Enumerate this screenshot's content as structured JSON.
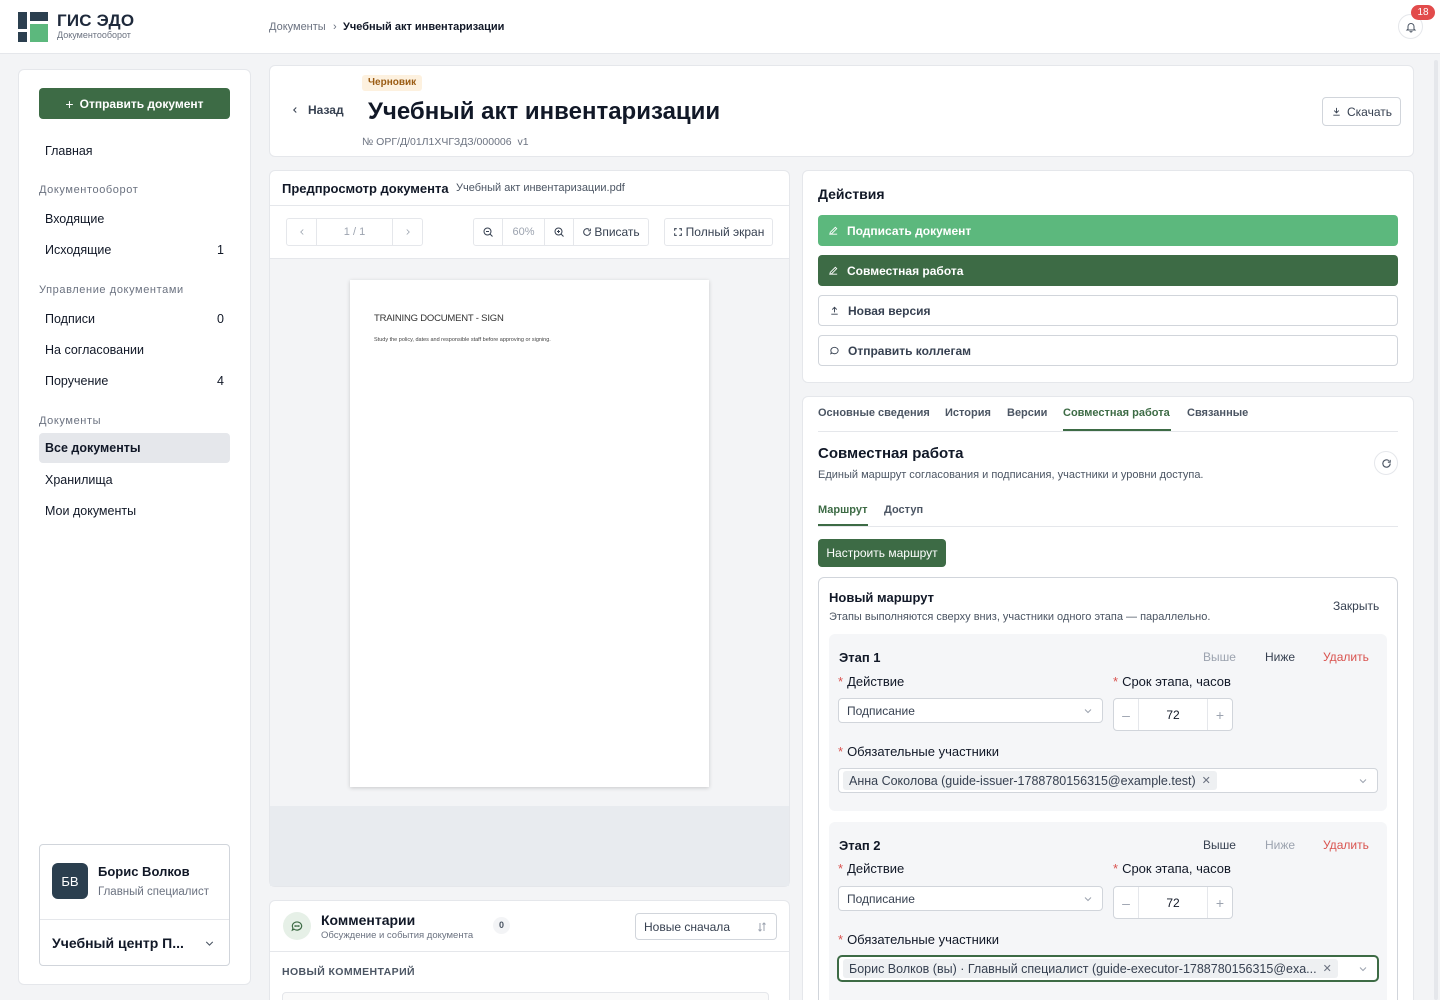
{
  "app": {
    "title": "ГИС ЭДО",
    "subtitle": "Документооборот"
  },
  "breadcrumb": {
    "parent": "Документы",
    "separator": "›",
    "current": "Учебный акт инвентаризации"
  },
  "notifications": {
    "count": "18",
    "icon": "bell-icon"
  },
  "sidebar": {
    "send_button": "Отправить документ",
    "home": "Главная",
    "groups": [
      {
        "title": "Документооборот",
        "items": [
          {
            "label": "Входящие",
            "count": ""
          },
          {
            "label": "Исходящие",
            "count": "1"
          }
        ]
      },
      {
        "title": "Управление документами",
        "items": [
          {
            "label": "Подписи",
            "count": "0"
          },
          {
            "label": "На согласовании",
            "count": ""
          },
          {
            "label": "Поручение",
            "count": "4"
          }
        ]
      },
      {
        "title": "Документы",
        "items": [
          {
            "label": "Все документы",
            "count": "",
            "active": true
          },
          {
            "label": "Хранилища",
            "count": ""
          },
          {
            "label": "Мои документы",
            "count": ""
          }
        ]
      }
    ],
    "user": {
      "initials": "БВ",
      "name": "Борис Волков",
      "role": "Главный специалист",
      "org": "Учебный центр П..."
    }
  },
  "header": {
    "back": "Назад",
    "status": "Черновик",
    "title": "Учебный акт инвентаризации",
    "number": "№ ОРГ/Д/01Л1ХЧГЗДЗ/000006",
    "version": "v1",
    "download": "Скачать"
  },
  "preview": {
    "title": "Предпросмотр документа",
    "file": "Учебный акт инвентаризации.pdf",
    "page_indicator": "1 / 1",
    "zoom": "60%",
    "fit": "Вписать",
    "fullscreen": "Полный экран",
    "page_heading": "TRAINING DOCUMENT - SIGN",
    "page_text": "Study the policy, dates and responsible staff before approving or signing."
  },
  "comments": {
    "title": "Комментарии",
    "subtitle": "Обсуждение и события документа",
    "count": "0",
    "sort": "Новые сначала",
    "new_label": "НОВЫЙ КОММЕНТАРИЙ"
  },
  "actions": {
    "title": "Действия",
    "sign": "Подписать документ",
    "collab": "Совместная работа",
    "new_version": "Новая версия",
    "send_colleagues": "Отправить коллегам"
  },
  "tabs": [
    "Основные сведения",
    "История",
    "Версии",
    "Совместная работа",
    "Связанные"
  ],
  "collab": {
    "title": "Совместная работа",
    "subtitle": "Единый маршрут согласования и подписания, участники и уровни доступа.",
    "subtabs": [
      "Маршрут",
      "Доступ"
    ],
    "configure_route": "Настроить маршрут",
    "route": {
      "title": "Новый маршрут",
      "subtitle": "Этапы выполняются сверху вниз, участники одного этапа — параллельно.",
      "close": "Закрыть",
      "labels": {
        "up": "Выше",
        "down": "Ниже",
        "delete": "Удалить",
        "action": "Действие",
        "deadline": "Срок этапа, часов",
        "participants": "Обязательные участники"
      },
      "stages": [
        {
          "title": "Этап 1",
          "action": "Подписание",
          "hours": "72",
          "participant": "Анна Соколова (guide-issuer-1788780156315@example.test)"
        },
        {
          "title": "Этап 2",
          "action": "Подписание",
          "hours": "72",
          "participant": "Борис Волков (вы) · Главный специалист (guide-executor-1788780156315@exa..."
        }
      ]
    }
  }
}
